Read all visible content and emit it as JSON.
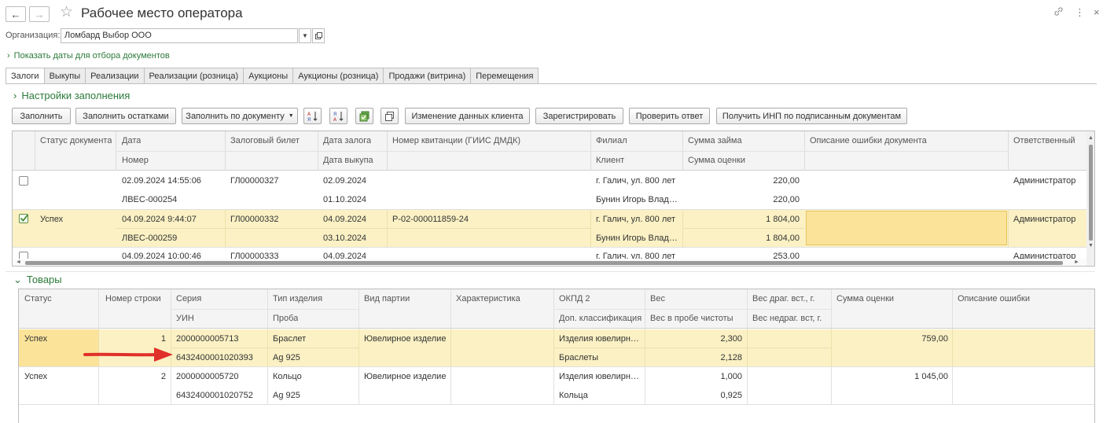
{
  "window": {
    "title": "Рабочее место оператора",
    "nav_back": "←",
    "nav_forward": "→",
    "link_glyph": "🔗",
    "more_glyph": "⋮",
    "close_glyph": "×"
  },
  "org": {
    "label": "Организация:",
    "value": "Ломбард Выбор ООО"
  },
  "show_dates_link": "Показать даты для отбора документов",
  "tabs": [
    "Залоги",
    "Выкупы",
    "Реализации",
    "Реализации (розница)",
    "Аукционы",
    "Аукционы (розница)",
    "Продажи (витрина)",
    "Перемещения"
  ],
  "settings_title": "Настройки заполнения",
  "toolbar": {
    "fill": "Заполнить",
    "fill_remaining": "Заполнить остатками",
    "fill_by_doc": "Заполнить по документу",
    "change_client": "Изменение данных клиента",
    "register": "Зарегистрировать",
    "check_answer": "Проверить ответ",
    "get_inp": "Получить ИНП по подписанным документам"
  },
  "docs_table": {
    "headers": {
      "status": "Статус документа",
      "date": "Дата",
      "number": "Номер",
      "ticket": "Залоговый билет",
      "pledge_date": "Дата залога",
      "buyout_date": "Дата выкупа",
      "receipt": "Номер квитанции (ГИИС ДМДК)",
      "branch": "Филиал",
      "client": "Клиент",
      "loan": "Сумма займа",
      "estimate": "Сумма оценки",
      "error_desc": "Описание ошибки документа",
      "responsible": "Ответственный"
    },
    "rows": [
      {
        "status": "",
        "date": "02.09.2024 14:55:06",
        "number": "ЛВЕС-000254",
        "ticket": "ГЛ00000327",
        "pledge_date": "02.09.2024",
        "buyout_date": "01.10.2024",
        "receipt": "",
        "branch": "г. Галич, ул. 800 лет",
        "client": "Бунин Игорь Влад…",
        "loan": "220,00",
        "estimate": "220,00",
        "error_desc": "",
        "responsible": "Администратор"
      },
      {
        "status": "Успех",
        "date": "04.09.2024 9:44:07",
        "number": "ЛВЕС-000259",
        "ticket": "ГЛ00000332",
        "pledge_date": "04.09.2024",
        "buyout_date": "03.10.2024",
        "receipt": "Р-02-000011859-24",
        "branch": "г. Галич, ул. 800 лет",
        "client": "Бунин Игорь Влад…",
        "loan": "1 804,00",
        "estimate": "1 804,00",
        "error_desc": "",
        "responsible": "Администратор"
      },
      {
        "status": "",
        "date": "04.09.2024 10:00:46",
        "number": "",
        "ticket": "ГЛ00000333",
        "pledge_date": "04.09.2024",
        "buyout_date": "",
        "receipt": "",
        "branch": "г. Галич, ул. 800 лет",
        "client": "",
        "loan": "253,00",
        "estimate": "",
        "error_desc": "",
        "responsible": "Администратор"
      }
    ]
  },
  "goods_title": "Товары",
  "goods_table": {
    "headers": {
      "status": "Статус",
      "line_no": "Номер строки",
      "series": "Серия",
      "uin": "УИН",
      "item_type": "Тип изделия",
      "probe": "Проба",
      "batch_type": "Вид партии",
      "characteristic": "Характеристика",
      "okpd": "ОКПД 2",
      "add_class": "Доп. классификация",
      "weight": "Вес",
      "weight_pure": "Вес в пробе чистоты",
      "weight_prec": "Вес драг. вст., г.",
      "weight_nonprec": "Вес недраг. вст, г.",
      "estimate": "Сумма оценки",
      "error_desc": "Описание ошибки"
    },
    "rows": [
      {
        "status": "Успех",
        "line_no": "1",
        "series": "2000000005713",
        "uin": "6432400001020393",
        "item_type": "Браслет",
        "probe": "Ag 925",
        "batch_type": "Ювелирное изделие",
        "characteristic": "",
        "okpd": "Изделия ювелирн…",
        "add_class": "Браслеты",
        "weight": "2,300",
        "weight_pure": "2,128",
        "estimate": "759,00"
      },
      {
        "status": "Успех",
        "line_no": "2",
        "series": "2000000005720",
        "uin": "6432400001020752",
        "item_type": "Кольцо",
        "probe": "Ag 925",
        "batch_type": "Ювелирное изделие",
        "characteristic": "",
        "okpd": "Изделия ювелирн…",
        "add_class": "Кольца",
        "weight": "1,000",
        "weight_pure": "0,925",
        "estimate": "1 045,00"
      }
    ]
  },
  "colors": {
    "accent_green": "#2c7a3a",
    "selected_row": "#fbf1c4",
    "highlight_cell": "#fbe39a",
    "arrow": "#e0302a"
  }
}
